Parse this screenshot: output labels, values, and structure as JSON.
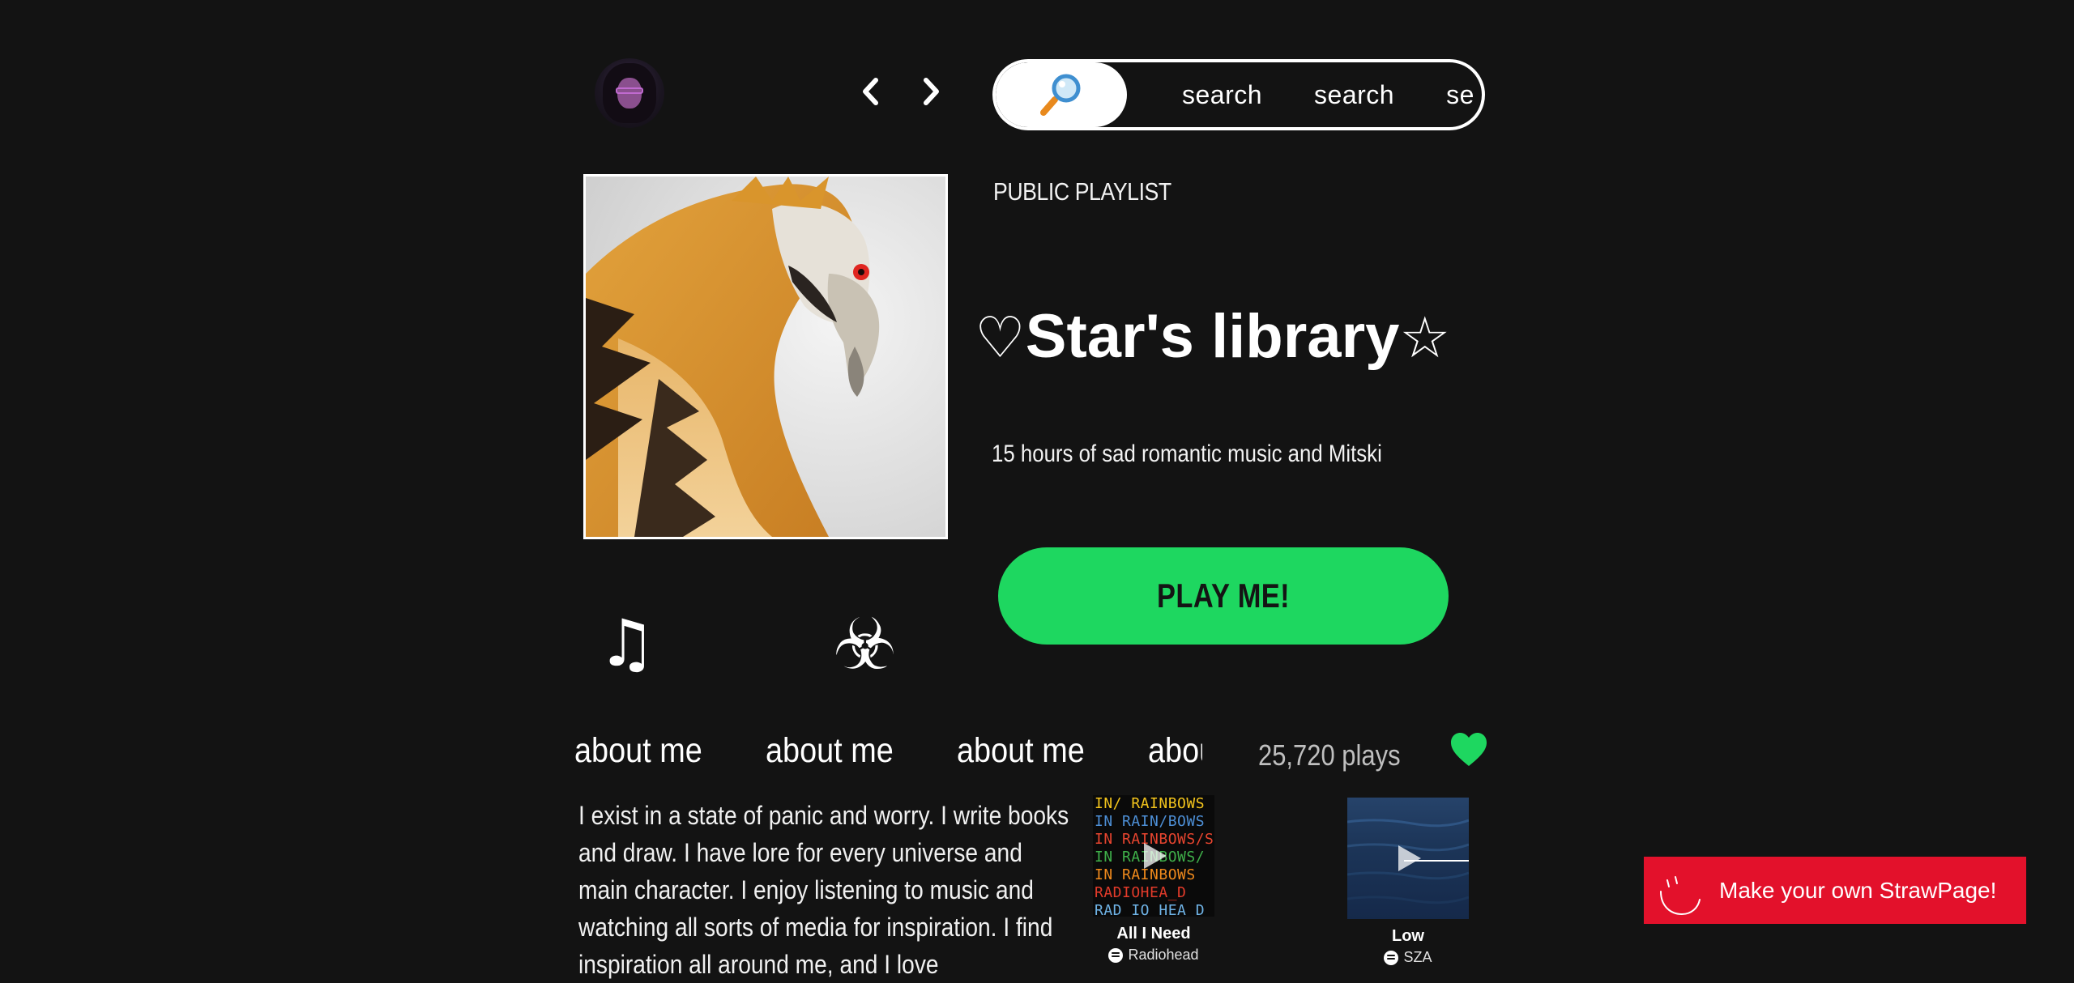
{
  "search": {
    "chips": [
      "search",
      "search",
      "se"
    ]
  },
  "playlist": {
    "label": "PUBLIC PLAYLIST",
    "title_left_glyph": "♡",
    "title_text": "Star's library",
    "title_right_glyph": "☆",
    "description": "15 hours of sad romantic music and Mitski",
    "play_button": "PLAY ME!"
  },
  "icons": {
    "music": "music-note-icon",
    "biohazard": "biohazard-icon",
    "heart": "heart-icon",
    "search": "magnifier-icon"
  },
  "about": {
    "marquee": [
      "about me",
      "about me",
      "about me",
      "about me"
    ],
    "plays": "25,720 plays",
    "bio": "I exist in a state of panic and worry. I write books and draw. I have lore for every universe and main character. I enjoy listening to music and watching all sorts of media for inspiration. I find inspiration all around me, and I love"
  },
  "tracks": [
    {
      "title": "All I Need",
      "artist": "Radiohead",
      "art_lines": [
        "IN/ RAINBOWS",
        "IN RAIN/BOWS",
        "IN RAINBOWS/S",
        "IN RAINBOWS/",
        "IN RAINBOWS",
        "RADIOHEA_D",
        " RAD IO HEA D"
      ]
    },
    {
      "title": "Low",
      "artist": "SZA"
    }
  ],
  "strawpage": {
    "label": "Make your own StrawPage!"
  },
  "colors": {
    "background": "#131313",
    "accent_green": "#1ed760",
    "straw_red": "#e3112b"
  }
}
